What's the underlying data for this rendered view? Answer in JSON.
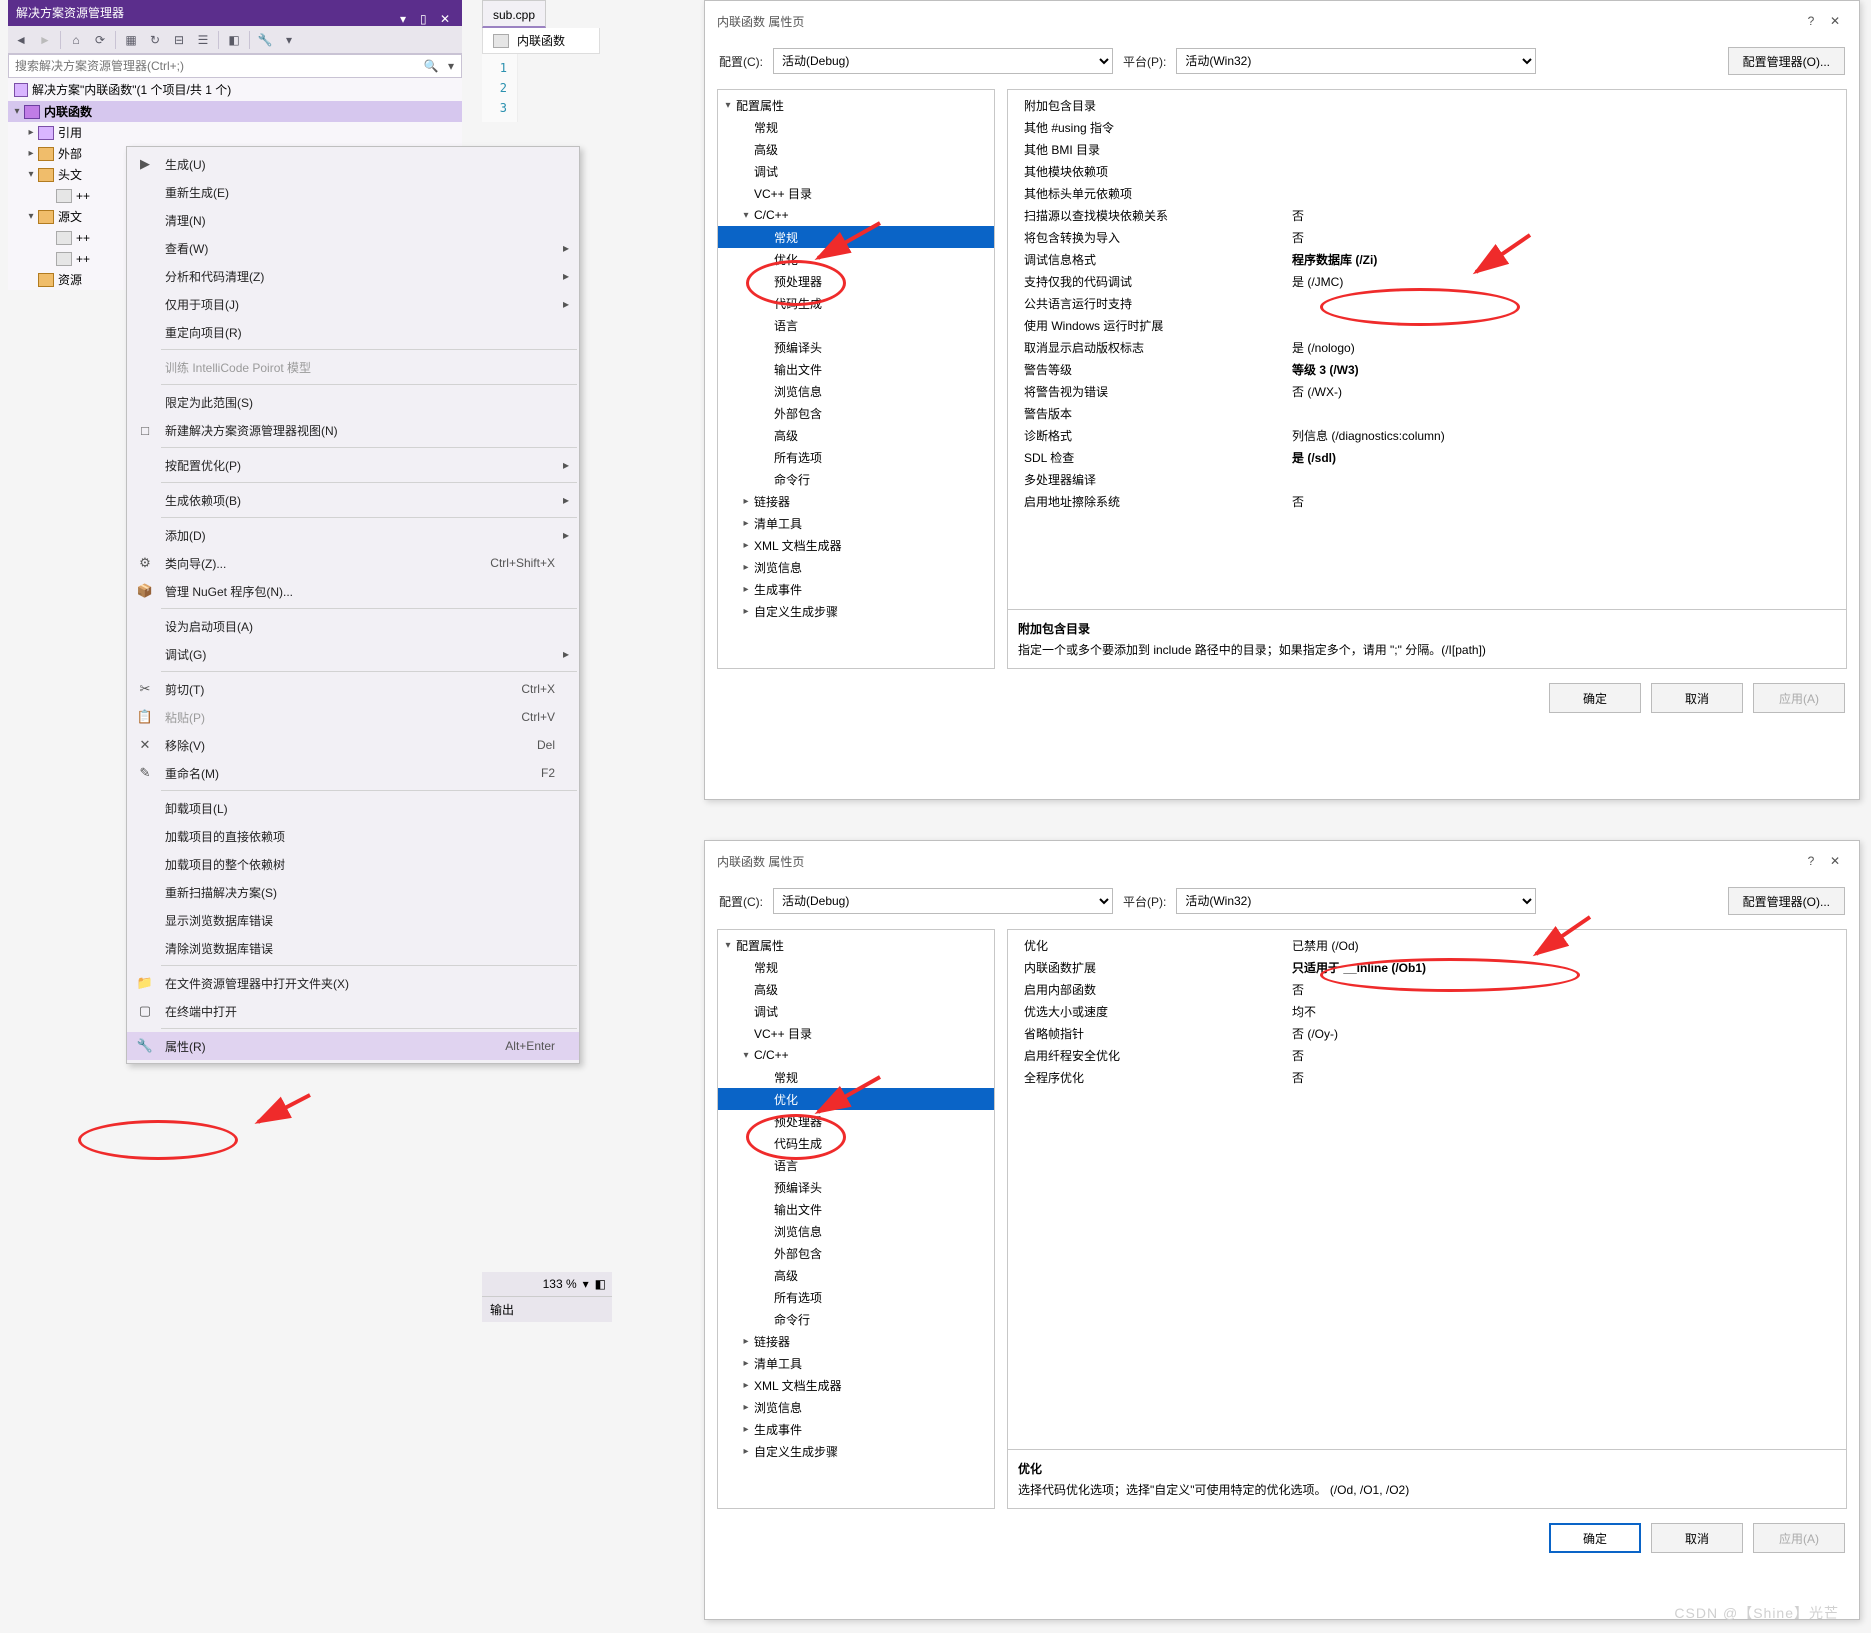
{
  "solution_explorer": {
    "title": "解决方案资源管理器",
    "search_placeholder": "搜索解决方案资源管理器(Ctrl+;)",
    "solution_text": "解决方案\"内联函数\"(1 个项目/共 1 个)",
    "tree": {
      "project": "内联函数",
      "filters": {
        "references": "引用",
        "external": "外部",
        "headers": "头文",
        "sources": "源文",
        "resources": "资源"
      },
      "headers_children": [
        "++"
      ],
      "sources_children": [
        "++",
        "++"
      ]
    }
  },
  "editor": {
    "tab": "sub.cpp",
    "sub_tab_icon": "++",
    "sub_tab_text": "内联函数",
    "lines": [
      "1",
      "2",
      "3"
    ]
  },
  "status": {
    "zoom": "133 %"
  },
  "output_panel": {
    "title": "输出"
  },
  "context_menu": [
    {
      "icon": "▶",
      "label": "生成(U)"
    },
    {
      "label": "重新生成(E)"
    },
    {
      "label": "清理(N)"
    },
    {
      "label": "查看(W)",
      "sub": true
    },
    {
      "label": "分析和代码清理(Z)",
      "sub": true
    },
    {
      "label": "仅用于项目(J)",
      "sub": true
    },
    {
      "label": "重定向项目(R)"
    },
    {
      "sep": true
    },
    {
      "label": "训练 IntelliCode Poirot 模型",
      "disabled": true
    },
    {
      "sep": true
    },
    {
      "label": "限定为此范围(S)"
    },
    {
      "icon": "□",
      "label": "新建解决方案资源管理器视图(N)"
    },
    {
      "sep": true
    },
    {
      "label": "按配置优化(P)",
      "sub": true
    },
    {
      "sep": true
    },
    {
      "label": "生成依赖项(B)",
      "sub": true
    },
    {
      "sep": true
    },
    {
      "label": "添加(D)",
      "sub": true
    },
    {
      "icon": "⚙",
      "label": "类向导(Z)...",
      "shortcut": "Ctrl+Shift+X"
    },
    {
      "icon": "📦",
      "label": "管理 NuGet 程序包(N)..."
    },
    {
      "sep": true
    },
    {
      "label": "设为启动项目(A)"
    },
    {
      "label": "调试(G)",
      "sub": true
    },
    {
      "sep": true
    },
    {
      "icon": "✂",
      "label": "剪切(T)",
      "shortcut": "Ctrl+X"
    },
    {
      "icon": "📋",
      "label": "粘贴(P)",
      "shortcut": "Ctrl+V",
      "disabled": true
    },
    {
      "icon": "✕",
      "label": "移除(V)",
      "shortcut": "Del"
    },
    {
      "icon": "✎",
      "label": "重命名(M)",
      "shortcut": "F2"
    },
    {
      "sep": true
    },
    {
      "label": "卸载项目(L)"
    },
    {
      "label": "加载项目的直接依赖项"
    },
    {
      "label": "加载项目的整个依赖树"
    },
    {
      "label": "重新扫描解决方案(S)"
    },
    {
      "label": "显示浏览数据库错误"
    },
    {
      "label": "清除浏览数据库错误"
    },
    {
      "sep": true
    },
    {
      "icon": "📁",
      "label": "在文件资源管理器中打开文件夹(X)"
    },
    {
      "icon": "▢",
      "label": "在终端中打开"
    },
    {
      "sep": true
    },
    {
      "icon": "🔧",
      "label": "属性(R)",
      "shortcut": "Alt+Enter",
      "hovered": true
    }
  ],
  "dialog": {
    "title": "内联函数 属性页",
    "config_label": "配置(C):",
    "config_value": "活动(Debug)",
    "platform_label": "平台(P):",
    "platform_value": "活动(Win32)",
    "config_mgr_btn": "配置管理器(O)...",
    "buttons": {
      "ok": "确定",
      "cancel": "取消",
      "apply": "应用(A)"
    }
  },
  "nav_tree": [
    {
      "label": "配置属性",
      "exp": true
    },
    {
      "label": "常规",
      "ind": 1
    },
    {
      "label": "高级",
      "ind": 1
    },
    {
      "label": "调试",
      "ind": 1
    },
    {
      "label": "VC++ 目录",
      "ind": 1
    },
    {
      "label": "C/C++",
      "ind": 1,
      "exp": true
    },
    {
      "label": "常规",
      "ind": 2,
      "sel1": true
    },
    {
      "label": "优化",
      "ind": 2,
      "sel2": true
    },
    {
      "label": "预处理器",
      "ind": 2
    },
    {
      "label": "代码生成",
      "ind": 2
    },
    {
      "label": "语言",
      "ind": 2
    },
    {
      "label": "预编译头",
      "ind": 2
    },
    {
      "label": "输出文件",
      "ind": 2
    },
    {
      "label": "浏览信息",
      "ind": 2
    },
    {
      "label": "外部包含",
      "ind": 2
    },
    {
      "label": "高级",
      "ind": 2
    },
    {
      "label": "所有选项",
      "ind": 2
    },
    {
      "label": "命令行",
      "ind": 2
    },
    {
      "label": "链接器",
      "ind": 1,
      "col": true
    },
    {
      "label": "清单工具",
      "ind": 1,
      "col": true
    },
    {
      "label": "XML 文档生成器",
      "ind": 1,
      "col": true
    },
    {
      "label": "浏览信息",
      "ind": 1,
      "col": true
    },
    {
      "label": "生成事件",
      "ind": 1,
      "col": true
    },
    {
      "label": "自定义生成步骤",
      "ind": 1,
      "col": true
    }
  ],
  "grid1": {
    "rows": [
      {
        "k": "附加包含目录",
        "v": ""
      },
      {
        "k": "其他 #using 指令",
        "v": ""
      },
      {
        "k": "其他 BMI 目录",
        "v": ""
      },
      {
        "k": "其他模块依赖项",
        "v": ""
      },
      {
        "k": "其他标头单元依赖项",
        "v": ""
      },
      {
        "k": "扫描源以查找模块依赖关系",
        "v": "否"
      },
      {
        "k": "将包含转换为导入",
        "v": "否"
      },
      {
        "k": "调试信息格式",
        "v": "程序数据库 (/Zi)",
        "bold": true
      },
      {
        "k": "支持仅我的代码调试",
        "v": "是 (/JMC)"
      },
      {
        "k": "公共语言运行时支持",
        "v": ""
      },
      {
        "k": "使用 Windows 运行时扩展",
        "v": ""
      },
      {
        "k": "取消显示启动版权标志",
        "v": "是 (/nologo)"
      },
      {
        "k": "警告等级",
        "v": "等级 3 (/W3)",
        "bold": true
      },
      {
        "k": "将警告视为错误",
        "v": "否 (/WX-)"
      },
      {
        "k": "警告版本",
        "v": ""
      },
      {
        "k": "诊断格式",
        "v": "列信息 (/diagnostics:column)"
      },
      {
        "k": "SDL 检查",
        "v": "是 (/sdl)",
        "bold": true
      },
      {
        "k": "多处理器编译",
        "v": ""
      },
      {
        "k": "启用地址擦除系统",
        "v": "否"
      }
    ],
    "desc_hd": "附加包含目录",
    "desc_body": "指定一个或多个要添加到 include 路径中的目录；如果指定多个，请用 \";\" 分隔。(/I[path])"
  },
  "grid2": {
    "rows": [
      {
        "k": "优化",
        "v": "已禁用 (/Od)"
      },
      {
        "k": "内联函数扩展",
        "v": "只适用于 __inline (/Ob1)",
        "bold": true
      },
      {
        "k": "启用内部函数",
        "v": "否"
      },
      {
        "k": "优选大小或速度",
        "v": "均不"
      },
      {
        "k": "省略帧指针",
        "v": "否 (/Oy-)"
      },
      {
        "k": "启用纤程安全优化",
        "v": "否"
      },
      {
        "k": "全程序优化",
        "v": "否"
      }
    ],
    "desc_hd": "优化",
    "desc_body": "选择代码优化选项；选择\"自定义\"可使用特定的优化选项。     (/Od, /O1, /O2)"
  },
  "watermark": "CSDN @【Shine】光芒"
}
